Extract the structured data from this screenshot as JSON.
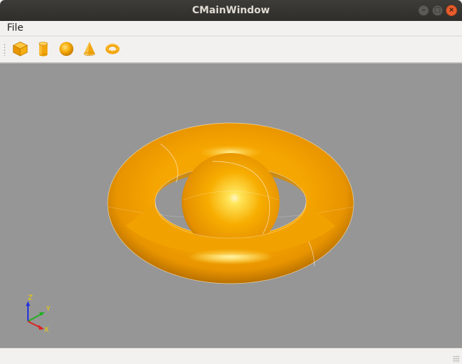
{
  "window": {
    "title": "CMainWindow",
    "controls": [
      "minimize",
      "maximize",
      "close"
    ]
  },
  "menubar": {
    "items": [
      {
        "label": "File"
      }
    ]
  },
  "toolbar": {
    "tools": [
      {
        "icon": "box-icon"
      },
      {
        "icon": "cylinder-icon"
      },
      {
        "icon": "sphere-icon"
      },
      {
        "icon": "cone-icon"
      },
      {
        "icon": "torus-icon"
      }
    ],
    "accent_color": "#f0a818"
  },
  "viewport": {
    "background_color": "#969696",
    "scene_objects": [
      "torus",
      "sphere"
    ],
    "object_color": "#f5a300",
    "axis_triad": {
      "z_label": "Z",
      "y_label": "Y",
      "x_label": "X",
      "x_color": "#e02020",
      "y_color": "#20b020",
      "z_color": "#2030e0",
      "label_color": "#f0d000"
    }
  }
}
